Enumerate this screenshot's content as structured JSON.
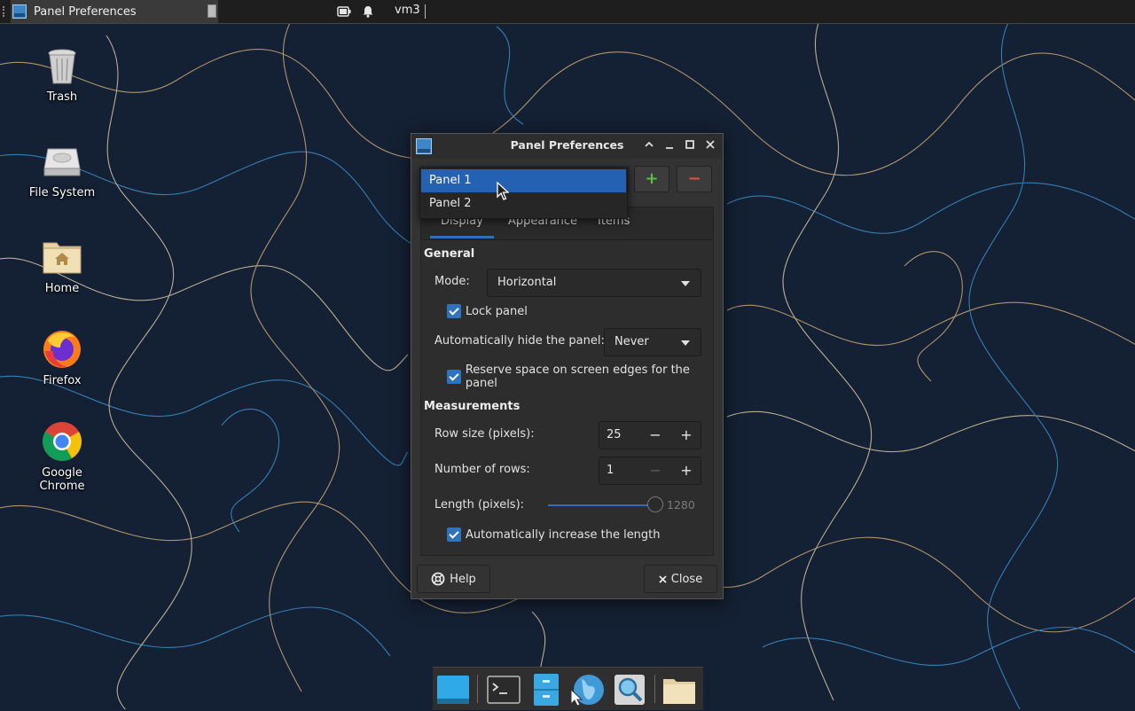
{
  "top_panel": {
    "task_title": "Panel Preferences",
    "username": "vm3"
  },
  "desktop_icons": [
    {
      "label": "Trash"
    },
    {
      "label": "File System"
    },
    {
      "label": "Home"
    },
    {
      "label": "Firefox"
    },
    {
      "label": "Google Chrome"
    }
  ],
  "dialog": {
    "title": "Panel Preferences",
    "panel_options": [
      "Panel 1",
      "Panel 2"
    ],
    "add_label": "+",
    "remove_label": "−",
    "tabs": [
      "Display",
      "Appearance",
      "Items"
    ],
    "general": {
      "title": "General",
      "mode_label": "Mode:",
      "mode_value": "Horizontal",
      "lock_label": "Lock panel",
      "autohide_label": "Automatically hide the panel:",
      "autohide_value": "Never",
      "reserve_label": "Reserve space on screen edges for the panel"
    },
    "measurements": {
      "title": "Measurements",
      "row_size_label": "Row size (pixels):",
      "row_size_value": "25",
      "rows_label": "Number of rows:",
      "rows_value": "1",
      "length_label": "Length (pixels):",
      "length_value": "1280",
      "auto_length_label": "Automatically increase the length"
    },
    "help_label": "Help",
    "close_label": "Close"
  },
  "colors": {
    "accent": "#2f6fb8",
    "selection": "#2461b2",
    "add": "#5fbd4b",
    "remove": "#e0504b"
  }
}
